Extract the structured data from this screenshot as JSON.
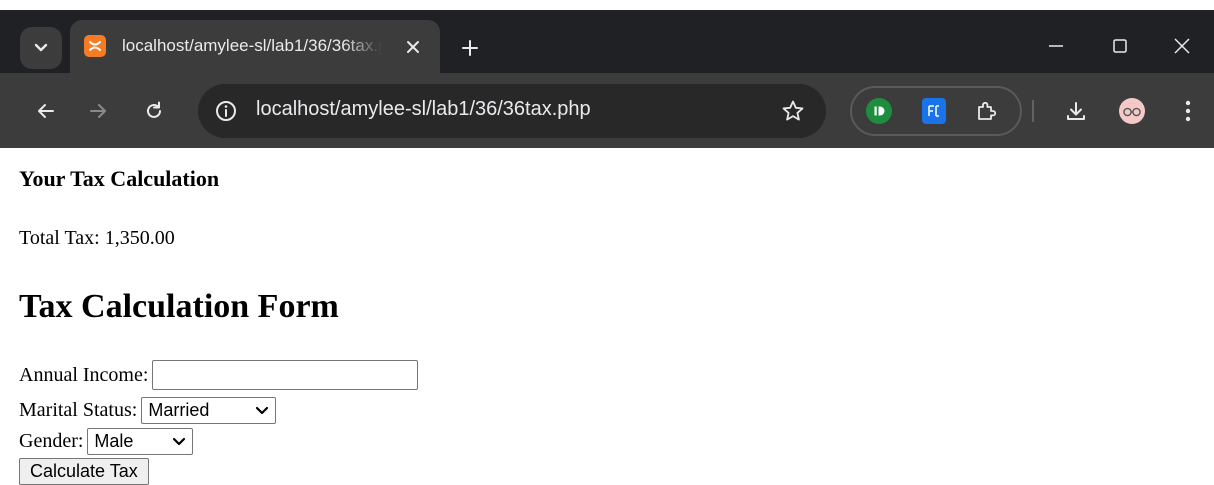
{
  "browser": {
    "tab_title": "localhost/amylee-sl/lab1/36/36tax.php",
    "address_url": "localhost/amylee-sl/lab1/36/36tax.php"
  },
  "page": {
    "result_heading": "Your Tax Calculation",
    "total_tax_text": "Total Tax: 1,350.00",
    "form_heading": "Tax Calculation Form",
    "income_label": "Annual Income:",
    "income_value": "",
    "marital_label": "Marital Status:",
    "marital_selected": "Married",
    "gender_label": "Gender:",
    "gender_selected": "Male",
    "submit_label": "Calculate Tax"
  },
  "colors": {
    "tabstrip": "#202124",
    "toolbar": "#3c3c3c",
    "favicon": "#f57c25",
    "ext_green": "#1e8e3e",
    "ext_blue": "#1a73e8"
  }
}
